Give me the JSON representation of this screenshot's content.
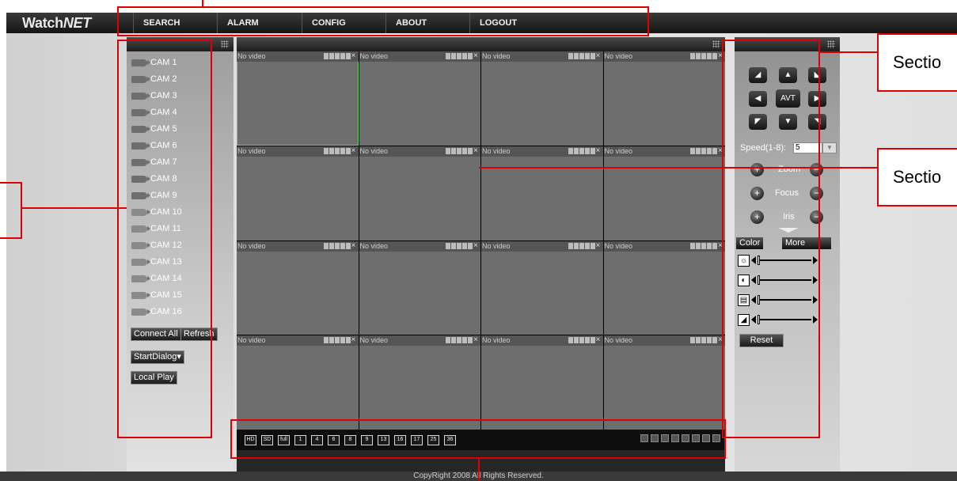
{
  "app": {
    "logo_main": "Watch",
    "logo_accent": "NET"
  },
  "nav": [
    "SEARCH",
    "ALARM",
    "CONFIG",
    "ABOUT",
    "LOGOUT"
  ],
  "cameras": [
    "CAM 1",
    "CAM 2",
    "CAM 3",
    "CAM 4",
    "CAM 5",
    "CAM 6",
    "CAM 7",
    "CAM 8",
    "CAM 9",
    "CAM 10",
    "CAM 11",
    "CAM 12",
    "CAM 13",
    "CAM 14",
    "CAM 15",
    "CAM 16"
  ],
  "camera_buttons": {
    "connect_all": "Connect All",
    "refresh": "Refresh",
    "start_dialog": "StartDialog",
    "local_play": "Local Play"
  },
  "video": {
    "cell_label": "No video",
    "cell_count": 16,
    "close_glyph": "×"
  },
  "layout_buttons": [
    "HD",
    "SD",
    "full",
    "1",
    "4",
    "6",
    "8",
    "9",
    "13",
    "16",
    "17",
    "25",
    "36"
  ],
  "ptz": {
    "center_label": "AVT",
    "speed_label": "Speed(1-8):",
    "speed_value": "5",
    "zoom_label": "Zoom",
    "focus_label": "Focus",
    "iris_label": "Iris",
    "plus": "+",
    "minus": "−"
  },
  "color_tabs": {
    "color": "Color",
    "more": "More"
  },
  "reset_label": "Reset",
  "footer": "CopyRight 2008 All Rights Reserved.",
  "callouts": {
    "top": "Sectio",
    "bottom": "Sectio"
  },
  "colors": {
    "annotation": "#e00000",
    "selected_cell": "#6bd66b"
  }
}
